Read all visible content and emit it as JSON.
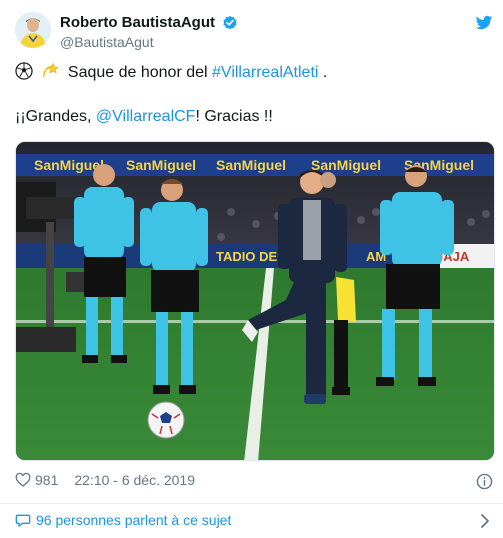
{
  "author": {
    "display_name": "Roberto BautistaAgut",
    "handle": "@BautistaAgut",
    "verified": true,
    "avatar_icon": "avatar-photo"
  },
  "tweet": {
    "line1_text": "Saque de honor del ",
    "line1_hashtag": "#VillarrealAtleti",
    "line1_end": " .",
    "line2_start": "¡¡Grandes, ",
    "line2_mention": "@VillarrealCF",
    "line2_end": "! Gracias !!",
    "emoji1": "soccer-ball-icon",
    "emoji2": "dizzy-star-icon"
  },
  "media": {
    "ad_boards": [
      "SanMiguel",
      "SanMiguel",
      "SanMiguel",
      "SanMiguel",
      "SanMiguel"
    ],
    "stadium_text": "TADIO DE",
    "stadium_text2": "AM",
    "stadium_text3": "JAJA"
  },
  "meta": {
    "likes": "981",
    "timestamp": "22:10 - 6 déc. 2019"
  },
  "conversation": {
    "label": "96 personnes parlent à ce sujet"
  },
  "colors": {
    "link": "#1b95e0",
    "muted": "#657786",
    "text": "#14171a",
    "pitch": "#2f7d32",
    "referee_shirt": "#3ec3e6"
  }
}
